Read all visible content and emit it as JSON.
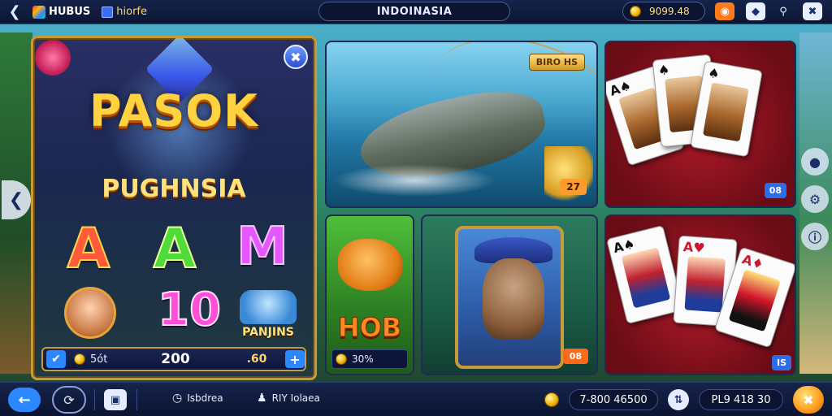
{
  "topbar": {
    "back_icon": "chevron-left-icon",
    "logo_primary": "HUBUS",
    "logo_secondary": "hiorfe",
    "region": "INDOINASIA",
    "balance": "9099.48",
    "icons": [
      "gift-icon",
      "diamond-icon",
      "search-icon",
      "close-icon"
    ]
  },
  "featured": {
    "title": "PASOK",
    "subtitle": "PUGHNSIA",
    "reel_symbols": [
      "A",
      "A",
      "M",
      "10"
    ],
    "symbol_label": "PANJINS",
    "bet": "5ót",
    "total": "200",
    "win": ".60"
  },
  "tiles": {
    "fish": {
      "badge": "BIRO HS",
      "count": "27"
    },
    "cards_top": {
      "badge": "08"
    },
    "hob": {
      "title": "HOB",
      "value": "30%"
    },
    "bear": {
      "count": "08"
    },
    "cards_bottom": {
      "badge": "IS"
    }
  },
  "bottombar": {
    "item1": "Isbdrea",
    "item2": "RIY Iolaea",
    "jackpot": "7-800 46500",
    "score": "PL9 418 30"
  },
  "colors": {
    "accent_gold": "#c79b3b",
    "accent_blue": "#2b88ff",
    "accent_orange": "#ff9b1a"
  }
}
